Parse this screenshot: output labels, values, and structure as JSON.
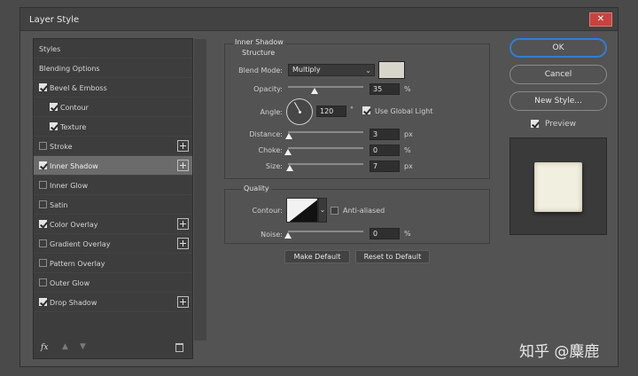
{
  "window": {
    "title": "Layer Style",
    "close_glyph": "✕"
  },
  "styles_list": {
    "items": [
      {
        "label": "Styles",
        "type": "plain"
      },
      {
        "label": "Blending Options",
        "type": "plain"
      },
      {
        "label": "Bevel & Emboss",
        "type": "check",
        "checked": true,
        "indent": 0,
        "plus": false
      },
      {
        "label": "Contour",
        "type": "check",
        "checked": true,
        "indent": 1,
        "plus": false
      },
      {
        "label": "Texture",
        "type": "check",
        "checked": true,
        "indent": 1,
        "plus": false
      },
      {
        "label": "Stroke",
        "type": "check",
        "checked": false,
        "indent": 0,
        "plus": true
      },
      {
        "label": "Inner Shadow",
        "type": "check",
        "checked": true,
        "indent": 0,
        "plus": true,
        "selected": true
      },
      {
        "label": "Inner Glow",
        "type": "check",
        "checked": false,
        "indent": 0,
        "plus": false
      },
      {
        "label": "Satin",
        "type": "check",
        "checked": false,
        "indent": 0,
        "plus": false
      },
      {
        "label": "Color Overlay",
        "type": "check",
        "checked": true,
        "indent": 0,
        "plus": true
      },
      {
        "label": "Gradient Overlay",
        "type": "check",
        "checked": false,
        "indent": 0,
        "plus": true
      },
      {
        "label": "Pattern Overlay",
        "type": "check",
        "checked": false,
        "indent": 0,
        "plus": false
      },
      {
        "label": "Outer Glow",
        "type": "check",
        "checked": false,
        "indent": 0,
        "plus": false
      },
      {
        "label": "Drop Shadow",
        "type": "check",
        "checked": true,
        "indent": 0,
        "plus": true
      }
    ],
    "footer": {
      "fx_label": "fx",
      "up_icon": "arrow-up-icon",
      "down_icon": "arrow-down-icon",
      "trash_icon": "trash-icon"
    }
  },
  "inner_shadow": {
    "section_title": "Inner Shadow",
    "structure_title": "Structure",
    "blend_mode_label": "Blend Mode:",
    "blend_mode_value": "Multiply",
    "shadow_color": "#d7d4c9",
    "opacity_label": "Opacity:",
    "opacity_value": "35",
    "opacity_unit": "%",
    "opacity_fraction": 0.35,
    "angle_label": "Angle:",
    "angle_value": "120",
    "angle_unit": "°",
    "angle_degrees": 120,
    "global_light_label": "Use Global Light",
    "global_light_checked": true,
    "distance_label": "Distance:",
    "distance_value": "3",
    "distance_unit": "px",
    "distance_fraction": 0.012,
    "choke_label": "Choke:",
    "choke_value": "0",
    "choke_unit": "%",
    "choke_fraction": 0,
    "size_label": "Size:",
    "size_value": "7",
    "size_unit": "px",
    "size_fraction": 0.028,
    "quality_title": "Quality",
    "contour_label": "Contour:",
    "anti_aliased_label": "Anti-aliased",
    "anti_aliased_checked": false,
    "noise_label": "Noise:",
    "noise_value": "0",
    "noise_unit": "%",
    "noise_fraction": 0,
    "make_default_label": "Make Default",
    "reset_default_label": "Reset to Default"
  },
  "actions": {
    "ok_label": "OK",
    "cancel_label": "Cancel",
    "new_style_label": "New Style...",
    "preview_label": "Preview",
    "preview_checked": true,
    "preview_color": "#f1efdf"
  },
  "watermark": {
    "text": "知乎 @麋鹿"
  },
  "colors": {
    "accent": "#2f7fd6",
    "close": "#c8433f",
    "panel": "#535353"
  }
}
